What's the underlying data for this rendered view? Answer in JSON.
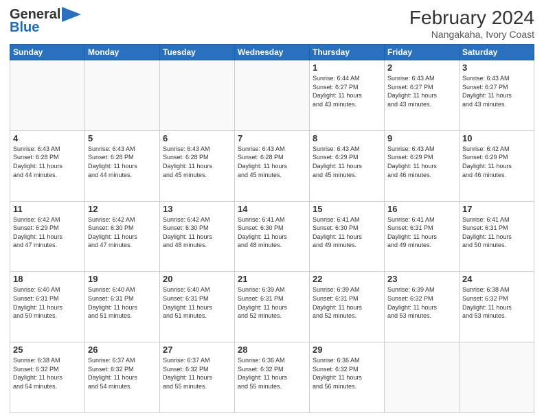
{
  "header": {
    "logo_general": "General",
    "logo_blue": "Blue",
    "month_year": "February 2024",
    "location": "Nangakaha, Ivory Coast"
  },
  "days_of_week": [
    "Sunday",
    "Monday",
    "Tuesday",
    "Wednesday",
    "Thursday",
    "Friday",
    "Saturday"
  ],
  "weeks": [
    [
      {
        "day": "",
        "info": ""
      },
      {
        "day": "",
        "info": ""
      },
      {
        "day": "",
        "info": ""
      },
      {
        "day": "",
        "info": ""
      },
      {
        "day": "1",
        "info": "Sunrise: 6:44 AM\nSunset: 6:27 PM\nDaylight: 11 hours\nand 43 minutes."
      },
      {
        "day": "2",
        "info": "Sunrise: 6:43 AM\nSunset: 6:27 PM\nDaylight: 11 hours\nand 43 minutes."
      },
      {
        "day": "3",
        "info": "Sunrise: 6:43 AM\nSunset: 6:27 PM\nDaylight: 11 hours\nand 43 minutes."
      }
    ],
    [
      {
        "day": "4",
        "info": "Sunrise: 6:43 AM\nSunset: 6:28 PM\nDaylight: 11 hours\nand 44 minutes."
      },
      {
        "day": "5",
        "info": "Sunrise: 6:43 AM\nSunset: 6:28 PM\nDaylight: 11 hours\nand 44 minutes."
      },
      {
        "day": "6",
        "info": "Sunrise: 6:43 AM\nSunset: 6:28 PM\nDaylight: 11 hours\nand 45 minutes."
      },
      {
        "day": "7",
        "info": "Sunrise: 6:43 AM\nSunset: 6:28 PM\nDaylight: 11 hours\nand 45 minutes."
      },
      {
        "day": "8",
        "info": "Sunrise: 6:43 AM\nSunset: 6:29 PM\nDaylight: 11 hours\nand 45 minutes."
      },
      {
        "day": "9",
        "info": "Sunrise: 6:43 AM\nSunset: 6:29 PM\nDaylight: 11 hours\nand 46 minutes."
      },
      {
        "day": "10",
        "info": "Sunrise: 6:42 AM\nSunset: 6:29 PM\nDaylight: 11 hours\nand 46 minutes."
      }
    ],
    [
      {
        "day": "11",
        "info": "Sunrise: 6:42 AM\nSunset: 6:29 PM\nDaylight: 11 hours\nand 47 minutes."
      },
      {
        "day": "12",
        "info": "Sunrise: 6:42 AM\nSunset: 6:30 PM\nDaylight: 11 hours\nand 47 minutes."
      },
      {
        "day": "13",
        "info": "Sunrise: 6:42 AM\nSunset: 6:30 PM\nDaylight: 11 hours\nand 48 minutes."
      },
      {
        "day": "14",
        "info": "Sunrise: 6:41 AM\nSunset: 6:30 PM\nDaylight: 11 hours\nand 48 minutes."
      },
      {
        "day": "15",
        "info": "Sunrise: 6:41 AM\nSunset: 6:30 PM\nDaylight: 11 hours\nand 49 minutes."
      },
      {
        "day": "16",
        "info": "Sunrise: 6:41 AM\nSunset: 6:31 PM\nDaylight: 11 hours\nand 49 minutes."
      },
      {
        "day": "17",
        "info": "Sunrise: 6:41 AM\nSunset: 6:31 PM\nDaylight: 11 hours\nand 50 minutes."
      }
    ],
    [
      {
        "day": "18",
        "info": "Sunrise: 6:40 AM\nSunset: 6:31 PM\nDaylight: 11 hours\nand 50 minutes."
      },
      {
        "day": "19",
        "info": "Sunrise: 6:40 AM\nSunset: 6:31 PM\nDaylight: 11 hours\nand 51 minutes."
      },
      {
        "day": "20",
        "info": "Sunrise: 6:40 AM\nSunset: 6:31 PM\nDaylight: 11 hours\nand 51 minutes."
      },
      {
        "day": "21",
        "info": "Sunrise: 6:39 AM\nSunset: 6:31 PM\nDaylight: 11 hours\nand 52 minutes."
      },
      {
        "day": "22",
        "info": "Sunrise: 6:39 AM\nSunset: 6:31 PM\nDaylight: 11 hours\nand 52 minutes."
      },
      {
        "day": "23",
        "info": "Sunrise: 6:39 AM\nSunset: 6:32 PM\nDaylight: 11 hours\nand 53 minutes."
      },
      {
        "day": "24",
        "info": "Sunrise: 6:38 AM\nSunset: 6:32 PM\nDaylight: 11 hours\nand 53 minutes."
      }
    ],
    [
      {
        "day": "25",
        "info": "Sunrise: 6:38 AM\nSunset: 6:32 PM\nDaylight: 11 hours\nand 54 minutes."
      },
      {
        "day": "26",
        "info": "Sunrise: 6:37 AM\nSunset: 6:32 PM\nDaylight: 11 hours\nand 54 minutes."
      },
      {
        "day": "27",
        "info": "Sunrise: 6:37 AM\nSunset: 6:32 PM\nDaylight: 11 hours\nand 55 minutes."
      },
      {
        "day": "28",
        "info": "Sunrise: 6:36 AM\nSunset: 6:32 PM\nDaylight: 11 hours\nand 55 minutes."
      },
      {
        "day": "29",
        "info": "Sunrise: 6:36 AM\nSunset: 6:32 PM\nDaylight: 11 hours\nand 56 minutes."
      },
      {
        "day": "",
        "info": ""
      },
      {
        "day": "",
        "info": ""
      }
    ]
  ]
}
